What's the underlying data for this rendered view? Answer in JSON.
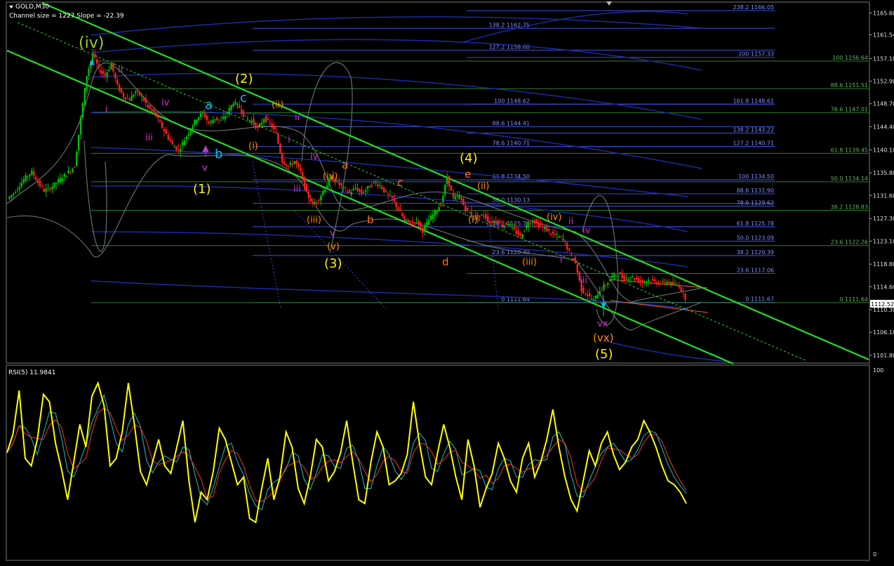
{
  "symbol_label": "GOLD,M30",
  "channel_info": "Channel size = 1227 Slope = -22.39",
  "rsi_label": "RSI(5) 11.9841",
  "current_price": "1112.52",
  "colors": {
    "background": "#000000",
    "up_candle": "#00c000",
    "down_candle": "#ff2020",
    "channel": "#20e020",
    "fib_blue": "#3a4fd8",
    "fib_green": "#2e7d2e",
    "band": "#7a8a8a",
    "rsi_main": "#ffff00",
    "rsi_signal_red": "#ff3030",
    "rsi_signal_cyan": "#20c0c0"
  },
  "chart_data": [
    {
      "type": "candlestick",
      "title": "GOLD,M30",
      "subtitle": "Channel size = 1227 Slope = -22.39",
      "ylim": [
        1100.5,
        1167.5
      ],
      "y_ticks": [
        "1165.60",
        "1161.54",
        "1157.10",
        "1152.90",
        "1148.70",
        "1144.40",
        "1140.10",
        "1135.80",
        "1131.60",
        "1127.30",
        "1123.10",
        "1118.80",
        "1114.60",
        "1110.30",
        "1106.10",
        "1101.80"
      ],
      "close_path": [
        1131,
        1132,
        1133.5,
        1135,
        1136,
        1134,
        1132.5,
        1133,
        1134,
        1135,
        1136,
        1137,
        1146,
        1154,
        1158,
        1155,
        1154,
        1156,
        1152,
        1150,
        1149.5,
        1151,
        1150,
        1148,
        1147,
        1145,
        1143,
        1141,
        1140,
        1142,
        1144,
        1146,
        1147,
        1145,
        1146,
        1145.5,
        1147,
        1149,
        1148,
        1146,
        1145.5,
        1144,
        1146,
        1145,
        1143,
        1138,
        1137,
        1138,
        1136,
        1132,
        1130,
        1131,
        1133,
        1135,
        1134,
        1133,
        1132,
        1133,
        1132,
        1133,
        1134,
        1133.5,
        1132,
        1131,
        1129,
        1127,
        1126.5,
        1127,
        1125,
        1127,
        1128.5,
        1130,
        1135,
        1131,
        1131.5,
        1129,
        1128,
        1127.5,
        1128,
        1126.5,
        1127,
        1126,
        1126.5,
        1125,
        1124,
        1126,
        1127,
        1126,
        1125.5,
        1124.5,
        1124,
        1123.5,
        1121,
        1119,
        1114,
        1113,
        1112,
        1114,
        1115,
        1116.5,
        1117,
        1116,
        1116.5,
        1116,
        1115.5,
        1115.8,
        1115.5,
        1115.2,
        1115.5,
        1115,
        1114.8,
        1112.5
      ],
      "fib_levels_blue_left": [
        "138.2 1162.75",
        "127.2 1158.68",
        "100 1148.62",
        "88.6 1144.41",
        "78.6 1140.71",
        "61.8 1134.50",
        "50.0 1130.13",
        "38.2 1125.78",
        "23.6 1120.40",
        "0 1111.64"
      ],
      "fib_levels_blue_right": [
        "238.2 1166.05",
        "200 1157.33",
        "161.8 1148.61",
        "138.2 1143.22",
        "127.2 1140.71",
        "100 1134.50",
        "88.6 1131.90",
        "78.6 1129.62",
        "61.8 1125.78",
        "50.0 1123.09",
        "38.2 1120.39",
        "23.6 1117.06",
        "0 1111.67"
      ],
      "fib_levels_green": [
        "100 1156.64",
        "88.6 1151.51",
        "78.6 1147.01",
        "61.8 1139.45",
        "50.0 1134.14",
        "38.2 1128.83",
        "23.6 1122.26",
        "0 1111.64"
      ],
      "wave_labels": [
        "(iv)",
        "ii",
        "i",
        "iv",
        "iii",
        "a",
        "v",
        "b",
        "(1)",
        "(2)",
        "c",
        "(ii)",
        "(i)",
        "ii",
        "i",
        "iv",
        "iii",
        "(iv)",
        "a",
        "(iii)",
        "v",
        "(v)",
        "(3)",
        "b",
        "c",
        "d",
        "(4)",
        "e",
        "(ii)",
        "(i)",
        "(iii)",
        "(iv)",
        "ii",
        "i",
        "iv",
        "iii",
        "vx",
        "(vx)",
        "(5)",
        "v"
      ]
    },
    {
      "type": "line",
      "title": "RSI(5) 11.9841",
      "ylim": [
        0,
        100
      ],
      "y_ticks": [
        "100",
        "0"
      ],
      "series": [
        {
          "values": [
            55,
            65,
            88,
            52,
            48,
            62,
            86,
            82,
            60,
            46,
            30,
            50,
            70,
            58,
            85,
            92,
            80,
            48,
            52,
            66,
            92,
            70,
            45,
            38,
            50,
            62,
            48,
            44,
            58,
            72,
            40,
            18,
            34,
            30,
            45,
            68,
            62,
            50,
            38,
            42,
            20,
            18,
            36,
            52,
            30,
            42,
            66,
            58,
            36,
            28,
            42,
            62,
            58,
            40,
            45,
            55,
            72,
            50,
            30,
            28,
            50,
            66,
            58,
            38,
            40,
            44,
            54,
            82,
            60,
            42,
            38,
            55,
            70,
            58,
            42,
            30,
            62,
            48,
            26,
            36,
            44,
            60,
            52,
            40,
            34,
            52,
            60,
            42,
            50,
            62,
            78,
            58,
            42,
            30,
            24,
            40,
            56,
            48,
            60,
            66,
            54,
            46,
            50,
            58,
            62,
            72,
            66,
            58,
            48,
            40,
            38,
            34,
            28
          ]
        }
      ]
    }
  ]
}
